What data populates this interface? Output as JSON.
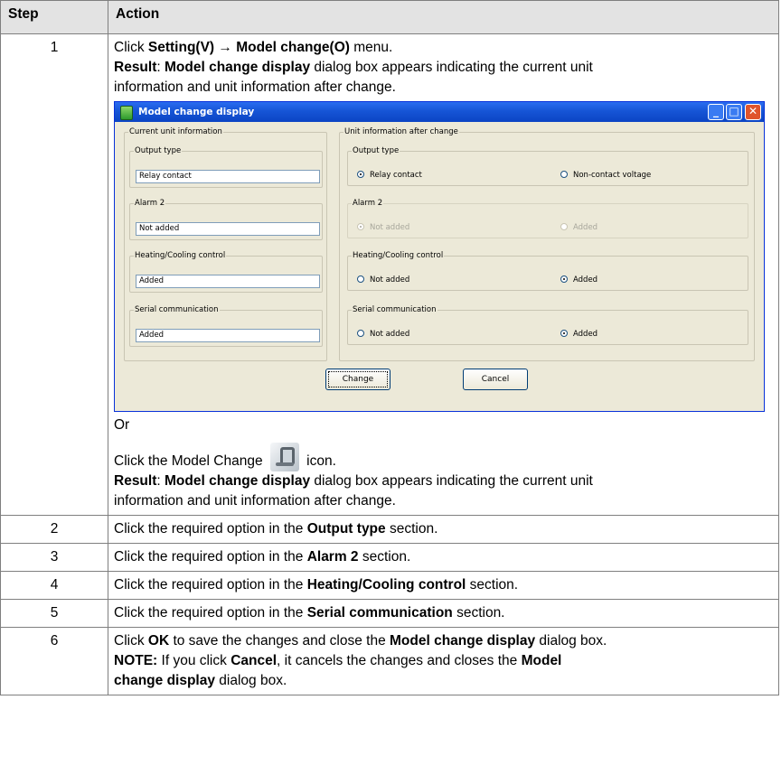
{
  "headers": {
    "step": "Step",
    "action": "Action"
  },
  "step1": {
    "num": "1",
    "line1_pre": "Click ",
    "line1_b1": "Setting(V)",
    "line1_arrow": " → ",
    "line1_b2": "Model change(O)",
    "line1_post": " menu.",
    "result_label": "Result",
    "result_colon": ": ",
    "result_b": "Model change display",
    "result_post1": " dialog box appears indicating the current unit",
    "result_post2": "information and unit information after change.",
    "or": "Or",
    "icon_pre": "Click the Model Change ",
    "icon_post": " icon.",
    "result2_post1": " dialog box appears indicating the current unit",
    "result2_post2": "information and unit information after change."
  },
  "dialog": {
    "title": "Model change display",
    "current_group": "Current unit information",
    "after_group": "Unit information after change",
    "output_type_label": "Output type",
    "output_type_value": "Relay contact",
    "alarm2_label": "Alarm 2",
    "alarm2_value": "Not added",
    "heating_label": "Heating/Cooling control",
    "heating_value": "Added",
    "serial_label": "Serial communication",
    "serial_value": "Added",
    "opt_relay": "Relay contact",
    "opt_noncontact": "Non-contact voltage",
    "opt_not_added": "Not added",
    "opt_added": "Added",
    "change_btn": "Change",
    "cancel_btn": "Cancel"
  },
  "steps": [
    {
      "num": "2",
      "pre": "Click the required option in the ",
      "b": "Output type",
      "post": " section."
    },
    {
      "num": "3",
      "pre": "Click the required option in the ",
      "b": "Alarm 2",
      "post": " section."
    },
    {
      "num": "4",
      "pre": "Click the required option in the ",
      "b": "Heating/Cooling control",
      "post": " section."
    },
    {
      "num": "5",
      "pre": "Click the required option in the ",
      "b": "Serial communication",
      "post": " section."
    }
  ],
  "step6": {
    "num": "6",
    "pre": "Click ",
    "ok": "OK",
    "mid": " to save the changes and close the ",
    "b1": "Model change display",
    "post": " dialog box.",
    "note": "NOTE:",
    "note_pre": " If you click ",
    "cancel": "Cancel",
    "note_mid": ", it cancels the changes and closes the ",
    "b2a": "Model",
    "b2b": "change display",
    "note_post": " dialog box."
  }
}
